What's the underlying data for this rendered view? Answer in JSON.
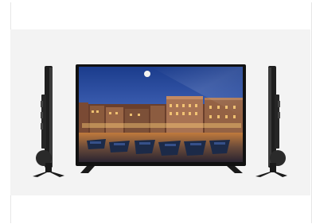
{
  "image": {
    "subject": "flat-screen-tv-product-views",
    "views": [
      "left-side",
      "front",
      "right-side"
    ],
    "background_color": "#f3f3f3",
    "frame_color": "#ffffff"
  }
}
